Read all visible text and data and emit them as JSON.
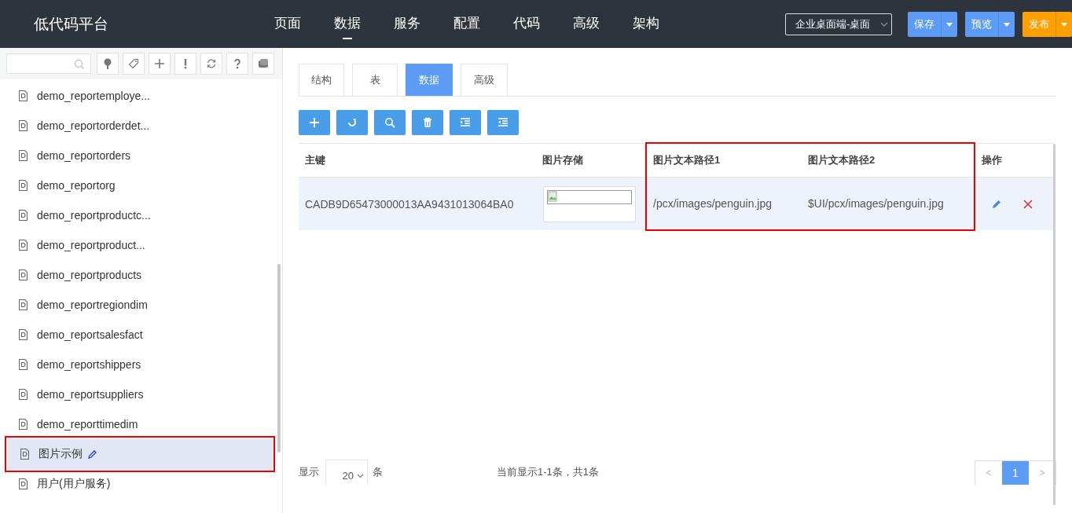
{
  "app": {
    "title": "低代码平台"
  },
  "nav": [
    {
      "label": "页面",
      "selected": false
    },
    {
      "label": "数据",
      "selected": true
    },
    {
      "label": "服务",
      "selected": false
    },
    {
      "label": "配置",
      "selected": false
    },
    {
      "label": "代码",
      "selected": false
    },
    {
      "label": "高级",
      "selected": false
    },
    {
      "label": "架构",
      "selected": false
    }
  ],
  "platform_select": {
    "value": "企业桌面端-桌面"
  },
  "actions": [
    {
      "label": "保存",
      "kind": "primary"
    },
    {
      "label": "预览",
      "kind": "primary"
    },
    {
      "label": "发布",
      "kind": "warning"
    }
  ],
  "sidebar": {
    "items": [
      {
        "label": "demo_reportemploye...",
        "selected": false,
        "highlighted": false
      },
      {
        "label": "demo_reportorderdet...",
        "selected": false,
        "highlighted": false
      },
      {
        "label": "demo_reportorders",
        "selected": false,
        "highlighted": false
      },
      {
        "label": "demo_reportorg",
        "selected": false,
        "highlighted": false
      },
      {
        "label": "demo_reportproductc...",
        "selected": false,
        "highlighted": false
      },
      {
        "label": "demo_reportproduct...",
        "selected": false,
        "highlighted": false
      },
      {
        "label": "demo_reportproducts",
        "selected": false,
        "highlighted": false
      },
      {
        "label": "demo_reportregiondim",
        "selected": false,
        "highlighted": false
      },
      {
        "label": "demo_reportsalesfact",
        "selected": false,
        "highlighted": false
      },
      {
        "label": "demo_reportshippers",
        "selected": false,
        "highlighted": false
      },
      {
        "label": "demo_reportsuppliers",
        "selected": false,
        "highlighted": false
      },
      {
        "label": "demo_reporttimedim",
        "selected": false,
        "highlighted": false
      },
      {
        "label": "图片示例",
        "selected": true,
        "highlighted": true,
        "editable": true
      },
      {
        "label": "用户(用户服务)",
        "selected": false,
        "highlighted": false
      }
    ]
  },
  "tabs": [
    {
      "label": "结构",
      "selected": false
    },
    {
      "label": "表",
      "selected": false
    },
    {
      "label": "数据",
      "selected": true
    },
    {
      "label": "高级",
      "selected": false
    }
  ],
  "table": {
    "columns": [
      {
        "label": "主键",
        "highlighted": false
      },
      {
        "label": "图片存储",
        "highlighted": false
      },
      {
        "label": "图片文本路径1",
        "highlighted": true
      },
      {
        "label": "图片文本路径2",
        "highlighted": true
      },
      {
        "label": "操作",
        "highlighted": false
      }
    ],
    "rows": [
      {
        "cells": [
          {
            "kind": "text",
            "text": "CADB9D65473000013AA9431013064BA0"
          },
          {
            "kind": "image"
          },
          {
            "kind": "text",
            "text": "/pcx/images/penguin.jpg"
          },
          {
            "kind": "text",
            "text": "$UI/pcx/images/penguin.jpg"
          },
          {
            "kind": "actions"
          }
        ]
      }
    ]
  },
  "footer": {
    "show_label": "显示",
    "page_size": "20",
    "unit_label": "条",
    "summary": "当前显示1-1条，共1条",
    "pagination": {
      "prev": "<",
      "pages": [
        {
          "label": "1",
          "selected": true
        }
      ],
      "next": ">"
    }
  }
}
